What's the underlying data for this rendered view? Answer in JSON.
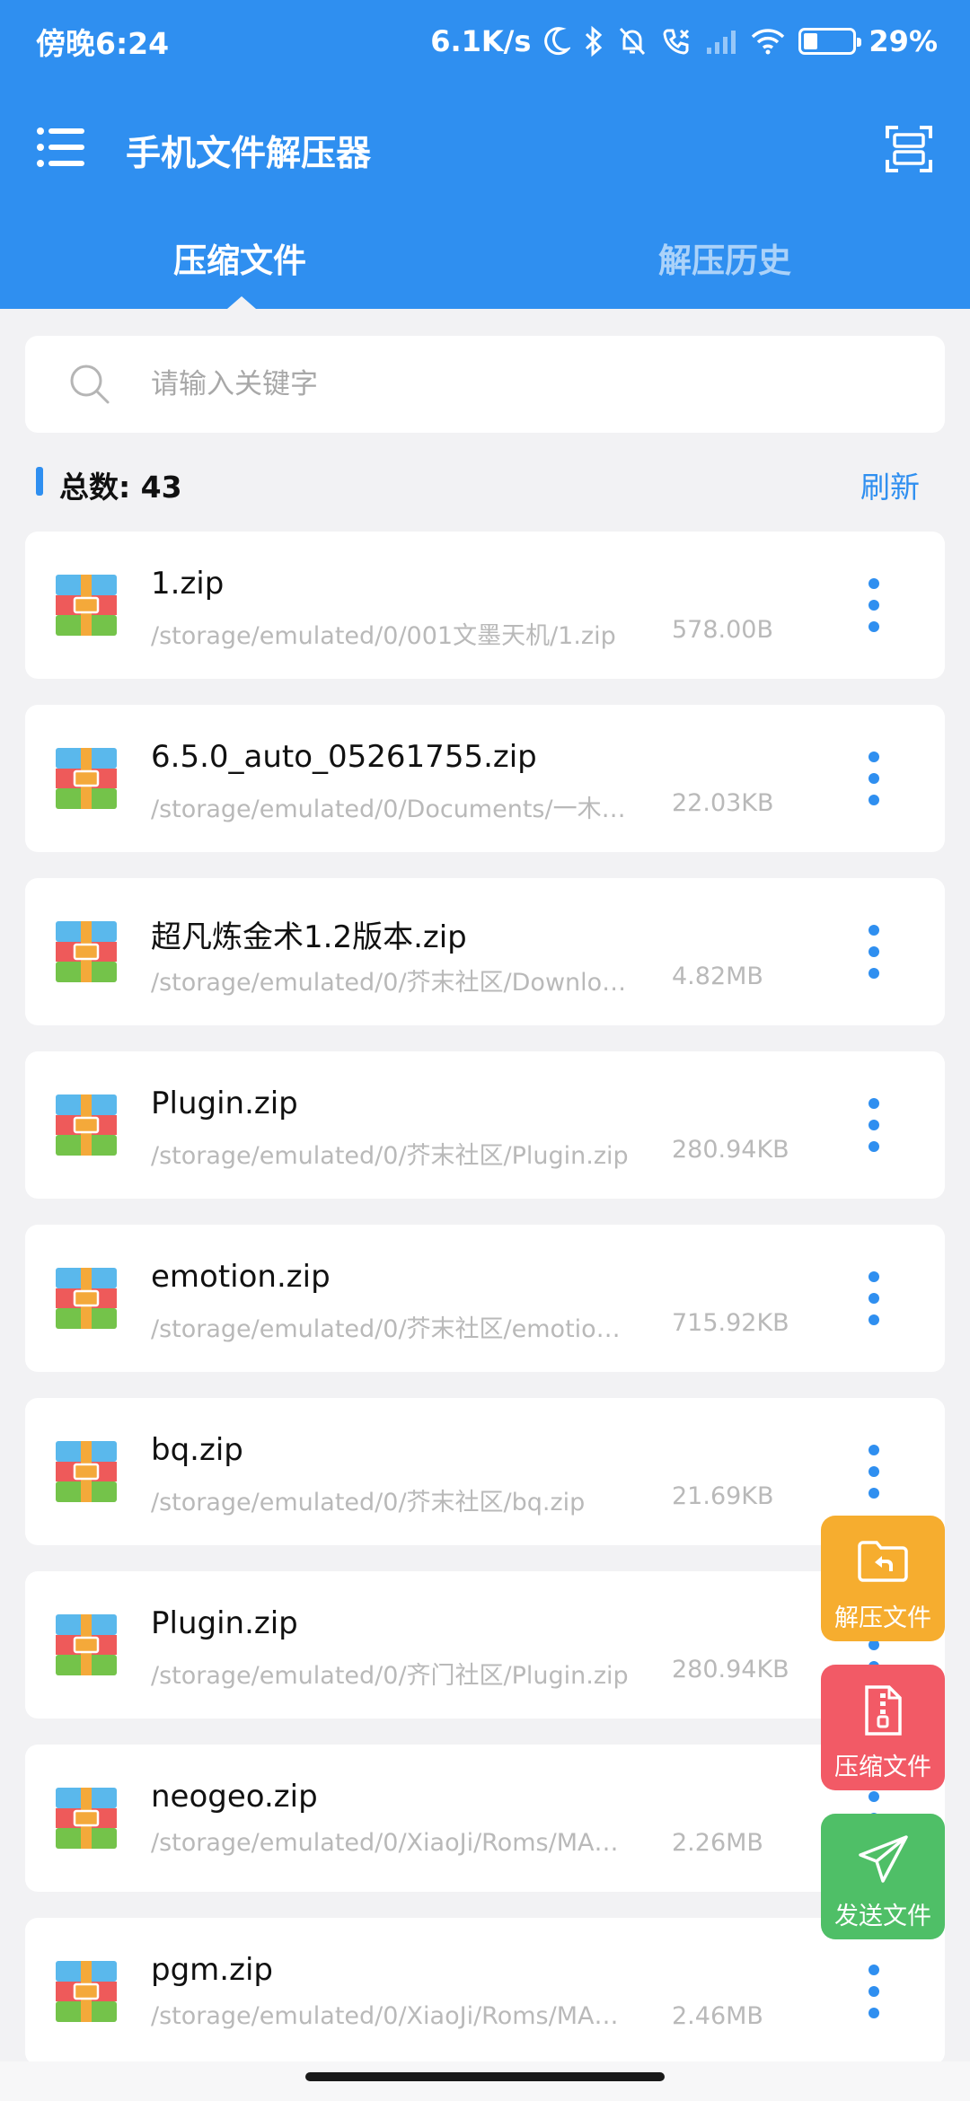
{
  "status_bar": {
    "time": "傍晚6:24",
    "net_speed": "6.1K/s",
    "battery": "29%",
    "battery_level": 0.29
  },
  "toolbar": {
    "title": "手机文件解压器"
  },
  "tabs": [
    {
      "label": "压缩文件",
      "active": true
    },
    {
      "label": "解压历史",
      "active": false
    }
  ],
  "search": {
    "placeholder": "请输入关键字"
  },
  "summary": {
    "count_label": "总数: 43",
    "refresh_label": "刷新"
  },
  "files": [
    {
      "name": "1.zip",
      "path": "/storage/emulated/0/001文墨天机/1.zip",
      "size": "578.00B"
    },
    {
      "name": "6.5.0_auto_05261755.zip",
      "path": "/storage/emulated/0/Documents/一木…",
      "size": "22.03KB"
    },
    {
      "name": "超凡炼金术1.2版本.zip",
      "path": "/storage/emulated/0/芥末社区/Downlo…",
      "size": "4.82MB"
    },
    {
      "name": "Plugin.zip",
      "path": "/storage/emulated/0/芥末社区/Plugin.zip",
      "size": "280.94KB"
    },
    {
      "name": "emotion.zip",
      "path": "/storage/emulated/0/芥末社区/emotio…",
      "size": "715.92KB"
    },
    {
      "name": "bq.zip",
      "path": "/storage/emulated/0/芥末社区/bq.zip",
      "size": "21.69KB"
    },
    {
      "name": "Plugin.zip",
      "path": "/storage/emulated/0/齐门社区/Plugin.zip",
      "size": "280.94KB"
    },
    {
      "name": "neogeo.zip",
      "path": "/storage/emulated/0/XiaoJi/Roms/MA…",
      "size": "2.26MB"
    },
    {
      "name": "pgm.zip",
      "path": "/storage/emulated/0/XiaoJi/Roms/MA…",
      "size": "2.46MB"
    }
  ],
  "fabs": {
    "extract_label": "解压文件",
    "compress_label": "压缩文件",
    "send_label": "发送文件"
  },
  "colors": {
    "primary": "#2f8ff0",
    "extract": "#f6ad2f",
    "compress": "#f25a66",
    "send": "#4fbf67"
  },
  "icons": [
    "menu-icon",
    "scan-icon",
    "search-icon",
    "zip-archive-icon",
    "more-vertical-icon",
    "folder-return-icon",
    "zip-file-icon",
    "send-plane-icon"
  ]
}
